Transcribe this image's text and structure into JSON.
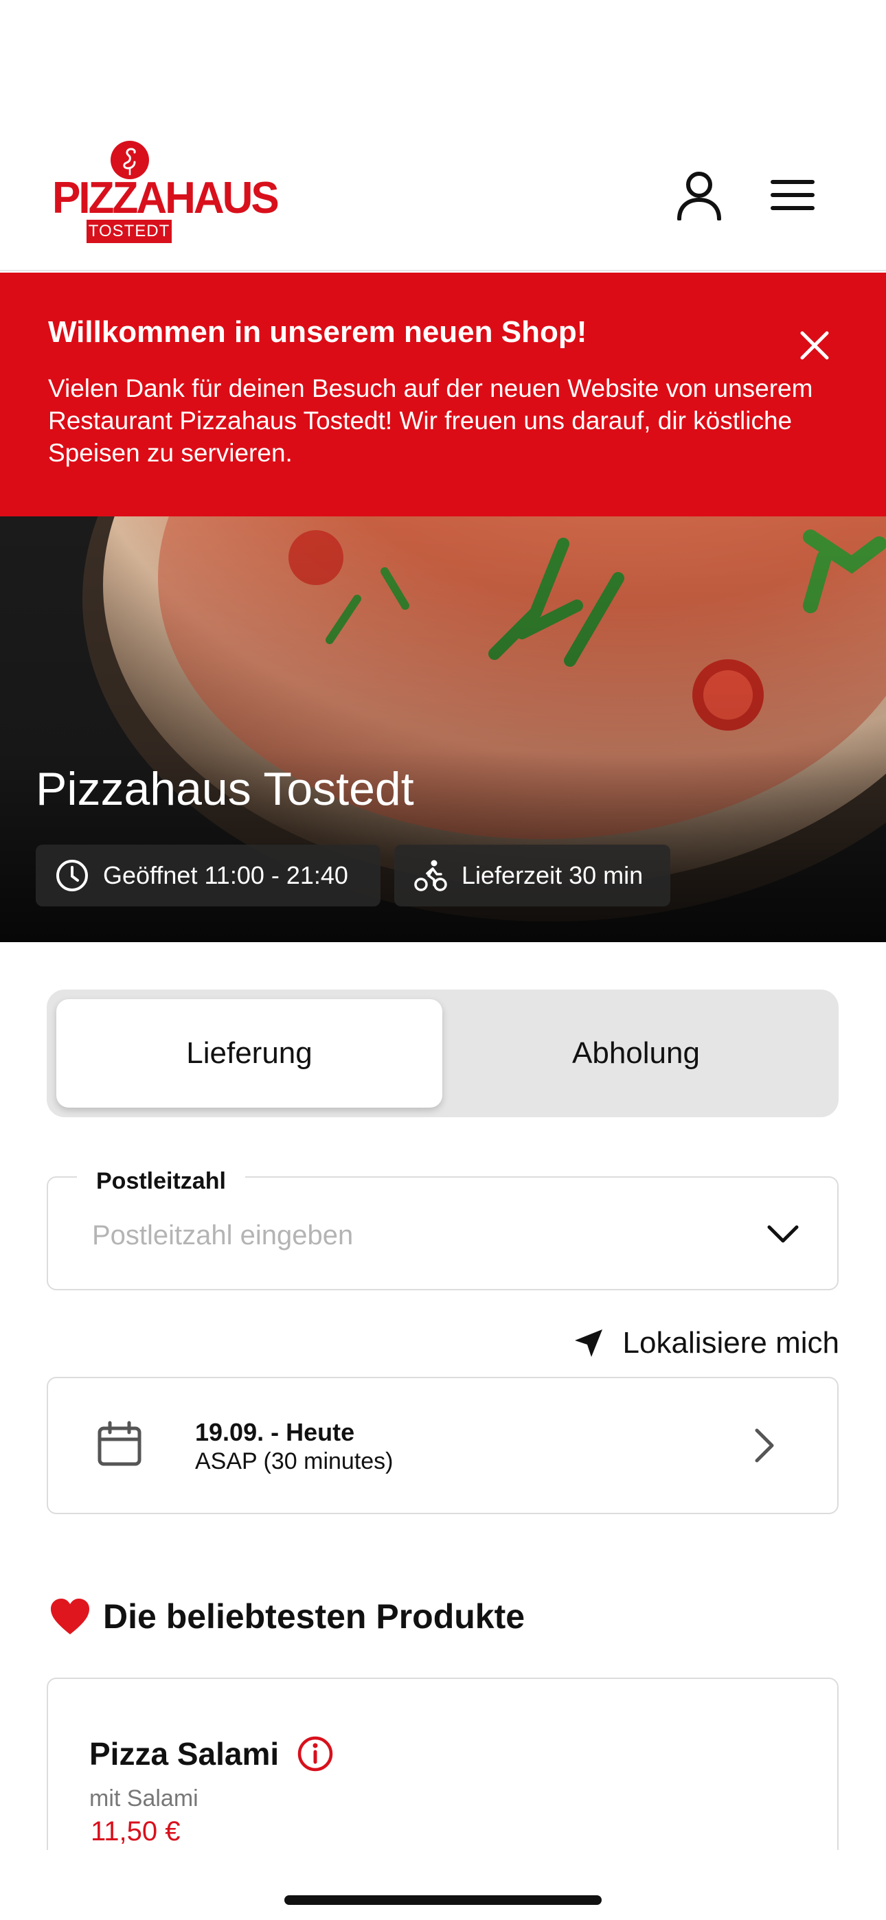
{
  "header": {
    "logo": {
      "name": "PIZZAHAUS",
      "sub": "TOSTEDT"
    },
    "icons": {
      "account": "user-icon",
      "menu": "hamburger-icon"
    },
    "brand_color": "#d8101c"
  },
  "banner": {
    "title": "Willkommen in unserem neuen Shop!",
    "text": "Vielen Dank für deinen Besuch auf der neuen Website von unserem Restaurant Pizzahaus Tostedt! Wir freuen uns darauf, dir köstliche Speisen zu servieren.",
    "background": "#dc0c16"
  },
  "hero": {
    "title": "Pizzahaus Tostedt",
    "opening": "Geöffnet 11:00 - 21:40",
    "delivery_time": "Lieferzeit 30 min"
  },
  "order_mode": {
    "options": [
      "Lieferung",
      "Abholung"
    ],
    "selected": "Lieferung"
  },
  "postcode": {
    "label": "Postleitzahl",
    "placeholder": "Postleitzahl eingeben",
    "value": ""
  },
  "locate": {
    "label": "Lokalisiere mich"
  },
  "timeslot": {
    "date": "19.09. - Heute",
    "time": "ASAP (30 minutes)"
  },
  "popular": {
    "title": "Die beliebtesten Produkte",
    "products": [
      {
        "name": "Pizza Salami",
        "description": "mit Salami",
        "price": "11,50 €"
      }
    ]
  }
}
